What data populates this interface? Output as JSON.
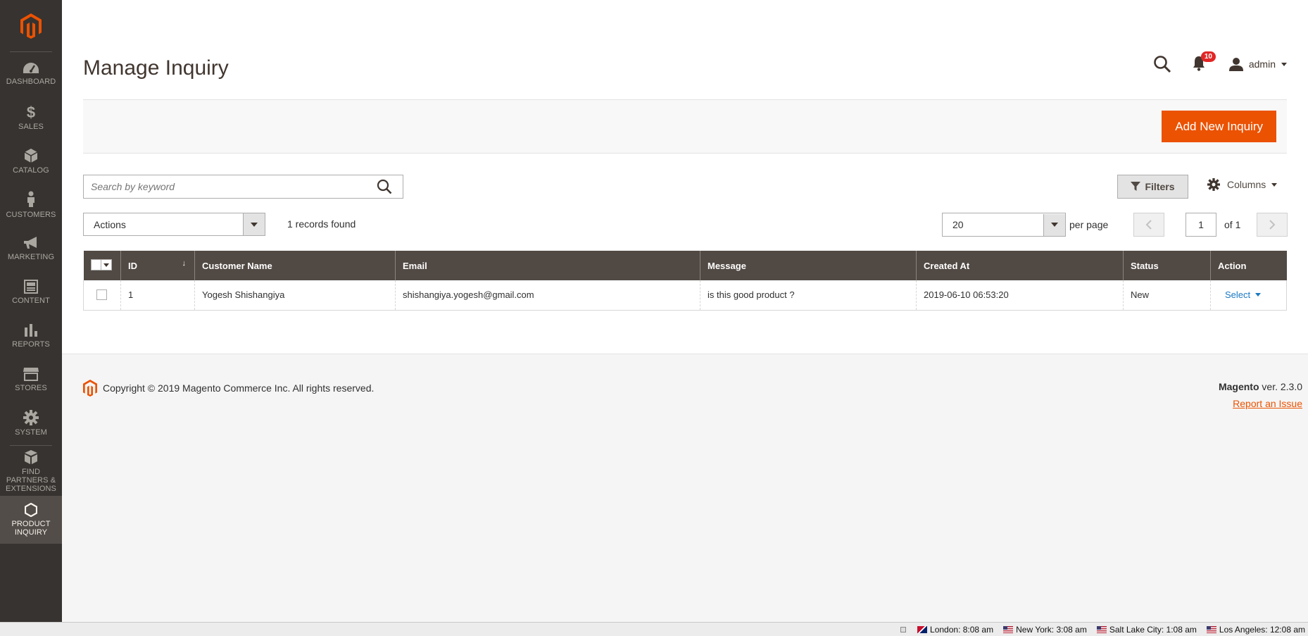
{
  "sidebar": {
    "items": [
      {
        "label": "Dashboard",
        "icon": "dashboard-icon"
      },
      {
        "label": "Sales",
        "icon": "dollar-icon"
      },
      {
        "label": "Catalog",
        "icon": "cube-icon"
      },
      {
        "label": "Customers",
        "icon": "person-icon"
      },
      {
        "label": "Marketing",
        "icon": "megaphone-icon"
      },
      {
        "label": "Content",
        "icon": "content-icon"
      },
      {
        "label": "Reports",
        "icon": "bar-chart-icon"
      },
      {
        "label": "Stores",
        "icon": "store-icon"
      },
      {
        "label": "System",
        "icon": "gear-icon"
      },
      {
        "label": "Find Partners & Extensions",
        "icon": "boxes-icon"
      },
      {
        "label": "Product Inquiry",
        "icon": "hexagon-icon"
      }
    ]
  },
  "header": {
    "title": "Manage Inquiry",
    "notifications_count": "10",
    "user": "admin"
  },
  "action_bar": {
    "add_button": "Add New Inquiry"
  },
  "toolbar": {
    "search_placeholder": "Search by keyword",
    "filters_label": "Filters",
    "columns_label": "Columns",
    "actions_label": "Actions",
    "records_found": "1 records found",
    "per_page_value": "20",
    "per_page_label": "per page",
    "current_page": "1",
    "page_total": "of 1"
  },
  "grid": {
    "columns": [
      "ID",
      "Customer Name",
      "Email",
      "Message",
      "Created At",
      "Status",
      "Action"
    ],
    "rows": [
      {
        "id": "1",
        "customer_name": "Yogesh Shishangiya",
        "email": "shishangiya.yogesh@gmail.com",
        "message": "is this good product ?",
        "created_at": "2019-06-10 06:53:20",
        "status": "New",
        "action": "Select"
      }
    ]
  },
  "footer": {
    "copyright": "Copyright © 2019 Magento Commerce Inc. All rights reserved.",
    "brand": "Magento",
    "version": " ver. 2.3.0",
    "report_link": "Report an Issue"
  },
  "clocks": [
    {
      "label": "London: 8:08 am",
      "flag": "uk"
    },
    {
      "label": "New York: 3:08 am",
      "flag": "us"
    },
    {
      "label": "Salt Lake City: 1:08 am",
      "flag": "us"
    },
    {
      "label": "Los Angeles: 12:08 am",
      "flag": "us"
    }
  ],
  "colors": {
    "sidebar_bg": "#373330",
    "primary": "#eb5202",
    "grid_header": "#514943",
    "link": "#1979c3",
    "badge": "#e22626"
  }
}
